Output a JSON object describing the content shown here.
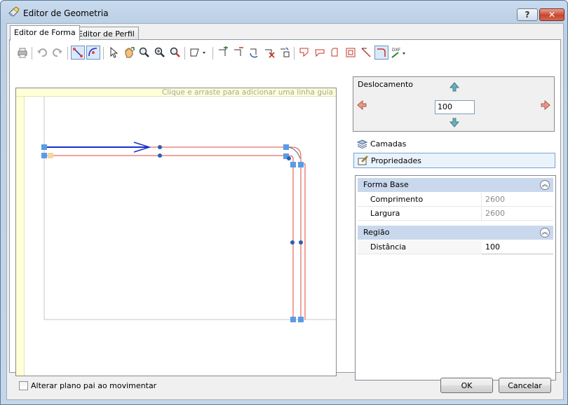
{
  "window": {
    "title": "Editor de Geometria",
    "help_label": "?",
    "close_label": "✕"
  },
  "tabs": [
    {
      "label": "Editor de Forma"
    },
    {
      "label": "Editor de Perfil"
    }
  ],
  "toolbar": {
    "icons": [
      "print-icon",
      "undo-icon",
      "redo-icon",
      "snap-line-icon",
      "snap-arc-icon",
      "select-arrow-icon",
      "pan-hand-icon",
      "zoom-icon",
      "zoom-in-icon",
      "zoom-out-icon",
      "shape-dropdown-icon",
      "add-vertex-icon",
      "remove-vertex-icon",
      "rotate-icon",
      "delete-segment-icon",
      "move-segment-icon",
      "bend-left-icon",
      "bend-right-icon",
      "corner-icon",
      "frame-icon",
      "diagonal-cut-icon",
      "arc-corner-icon",
      "dxf-export-icon"
    ]
  },
  "canvas": {
    "guide_hint": "Clique e arraste para adicionar uma linha guia"
  },
  "displacement": {
    "label": "Deslocamento",
    "value": "100"
  },
  "side": {
    "layers_label": "Camadas",
    "properties_label": "Propriedades"
  },
  "properties": {
    "base_shape": {
      "title": "Forma Base",
      "length_label": "Comprimento",
      "length_value": "2600",
      "width_label": "Largura",
      "width_value": "2600"
    },
    "region": {
      "title": "Região",
      "distance_label": "Distância",
      "distance_value": "100"
    }
  },
  "footer": {
    "checkbox_label": "Alterar plano pai ao movimentar",
    "ok_label": "OK",
    "cancel_label": "Cancelar"
  },
  "colors": {
    "shape_line": "#e04a3c",
    "active_segment": "#1a2fc8",
    "handle": "#5a9be8",
    "node": "#2c5fb0"
  }
}
